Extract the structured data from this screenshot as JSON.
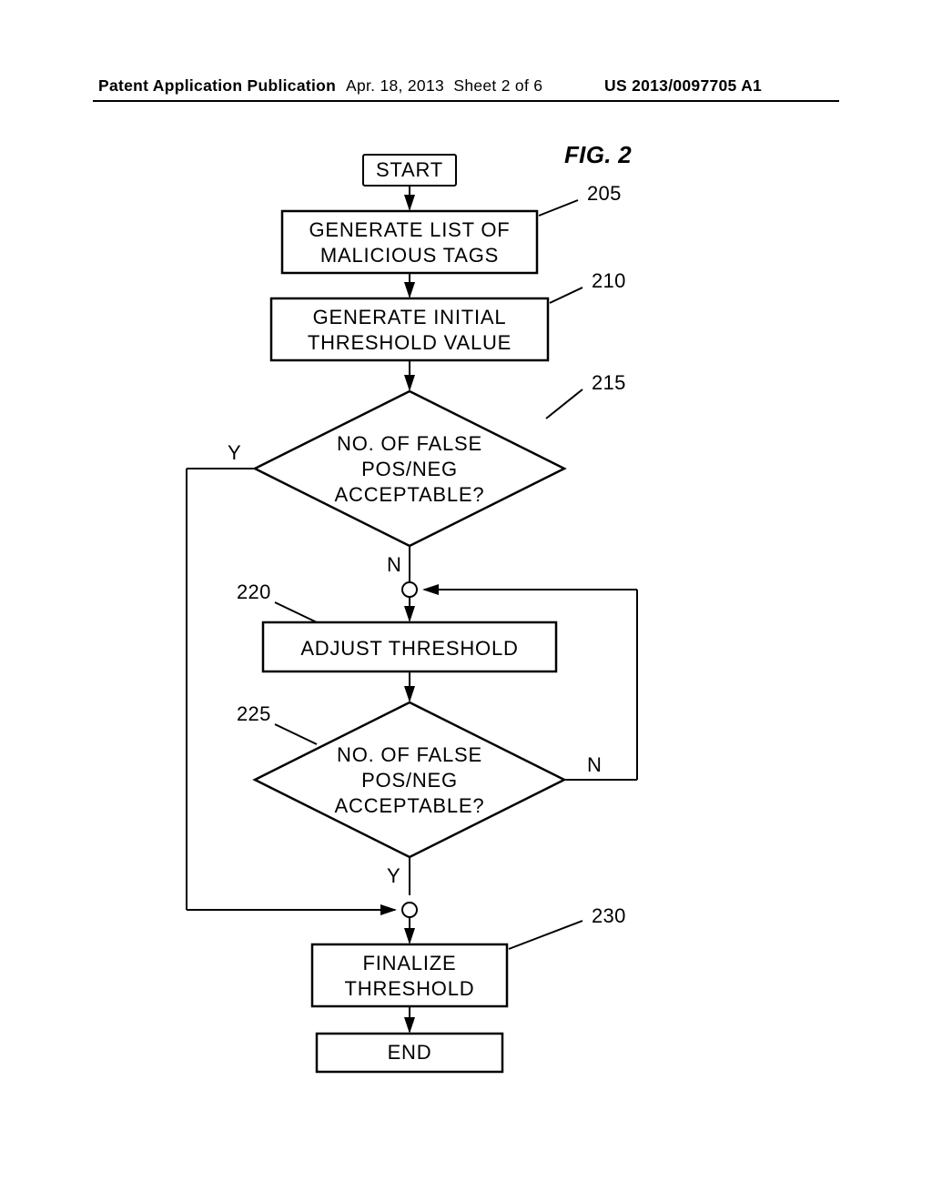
{
  "header": {
    "publication": "Patent Application Publication",
    "date": "Apr. 18, 2013",
    "sheet": "Sheet 2 of 6",
    "pubnum": "US 2013/0097705 A1"
  },
  "figure_label": "FIG. 2",
  "flowchart": {
    "start": "START",
    "end": "END",
    "step_205": {
      "line1": "GENERATE LIST OF",
      "line2": "MALICIOUS TAGS",
      "ref": "205"
    },
    "step_210": {
      "line1": "GENERATE INITIAL",
      "line2": "THRESHOLD VALUE",
      "ref": "210"
    },
    "dec_215": {
      "line1": "NO. OF FALSE",
      "line2": "POS/NEG",
      "line3": "ACCEPTABLE?",
      "ref": "215",
      "yes": "Y",
      "no": "N"
    },
    "step_220": {
      "line1": "ADJUST THRESHOLD",
      "ref": "220"
    },
    "dec_225": {
      "line1": "NO. OF FALSE",
      "line2": "POS/NEG",
      "line3": "ACCEPTABLE?",
      "ref": "225",
      "yes": "Y",
      "no": "N"
    },
    "step_230": {
      "line1": "FINALIZE",
      "line2": "THRESHOLD",
      "ref": "230"
    }
  }
}
